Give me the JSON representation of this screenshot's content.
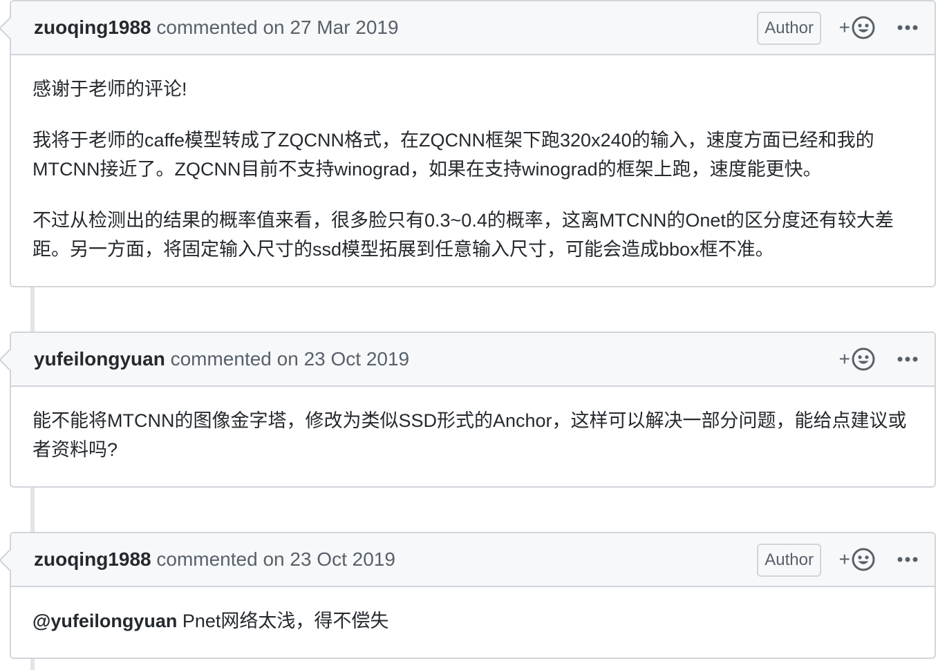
{
  "comments": [
    {
      "author": "zuoqing1988",
      "meta": "commented on 27 Mar 2019",
      "badge": "Author",
      "reaction_plus": "+",
      "paragraphs": [
        "感谢于老师的评论!",
        "我将于老师的caffe模型转成了ZQCNN格式，在ZQCNN框架下跑320x240的输入，速度方面已经和我的MTCNN接近了。ZQCNN目前不支持winograd，如果在支持winograd的框架上跑，速度能更快。",
        "不过从检测出的结果的概率值来看，很多脸只有0.3~0.4的概率，这离MTCNN的Onet的区分度还有较大差距。另一方面，将固定输入尺寸的ssd模型拓展到任意输入尺寸，可能会造成bbox框不准。"
      ]
    },
    {
      "author": "yufeilongyuan",
      "meta": "commented on 23 Oct 2019",
      "reaction_plus": "+",
      "paragraphs": [
        "能不能将MTCNN的图像金字塔，修改为类似SSD形式的Anchor，这样可以解决一部分问题，能给点建议或者资料吗?"
      ]
    },
    {
      "author": "zuoqing1988",
      "meta": "commented on 23 Oct 2019",
      "badge": "Author",
      "reaction_plus": "+",
      "mention": "@yufeilongyuan",
      "text": "Pnet网络太浅，得不偿失"
    }
  ],
  "icons": {
    "reaction": "smiley-icon",
    "more": "kebab-horizontal-icon"
  },
  "colors": {
    "header_bg": "#f6f8fa",
    "border": "#d1d5da",
    "text": "#24292e",
    "muted": "#586069",
    "timeline": "#e1e4e8"
  }
}
